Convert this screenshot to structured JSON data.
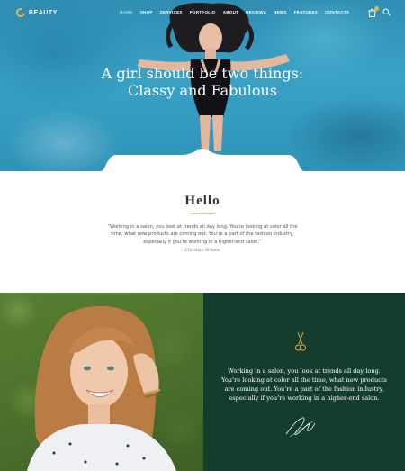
{
  "brand": {
    "name": "BEAUTY",
    "logo_icon": "ring-logo-icon",
    "accent": "#e9b44c"
  },
  "nav": {
    "items": [
      "HOME",
      "SHOP",
      "SERVICES",
      "PORTFOLIO",
      "ABOUT",
      "REVIEWS",
      "NEWS",
      "FEATURES",
      "CONTACTS"
    ],
    "active": "HOME",
    "cart_icon": "shopping-bag-icon",
    "search_icon": "search-icon"
  },
  "hero": {
    "title_line1": "A girl should be two things:",
    "title_line2": "Classy and Fabulous",
    "water_color": "#3aa2c6"
  },
  "hello": {
    "title": "Hello",
    "quote": "“Working in a salon, you look at trends all day long. You’re looking at color all the time, what new products are coming out. You’re a part of the fashion industry, especially if you’re working in a higher-end salon.”",
    "author": "Christian Siriano"
  },
  "feature": {
    "icon": "scissors-icon",
    "text": "Working in a salon, you look at trends all day long. You’re looking at color all the time, what new products are coming out. You’re a part of the fashion industry, especially if you’re working in a higher-end salon.",
    "signature": "signature",
    "panel_color": "#153d2e"
  }
}
